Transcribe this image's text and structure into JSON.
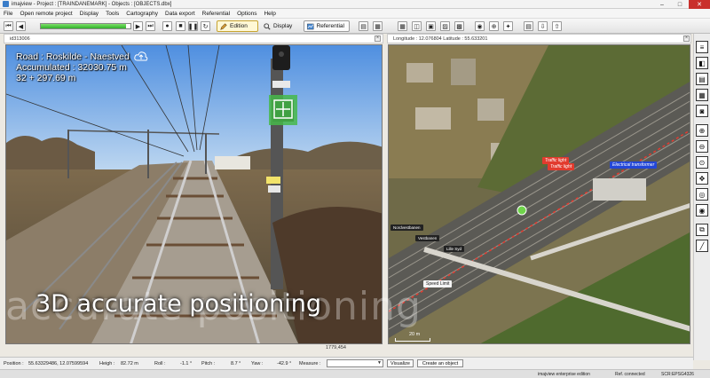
{
  "window": {
    "title": "imajview - Project : [TRAINDANEMARK] - Objects : [OBJECTS.dbx]",
    "controls": [
      "–",
      "□",
      "✕"
    ]
  },
  "menu": [
    "File",
    "Open remote project",
    "Display",
    "Tools",
    "Cartography",
    "Data export",
    "Referential",
    "Options",
    "Help"
  ],
  "toolbar": {
    "playback_buttons": [
      "⏮",
      "◀",
      "▶",
      "⏭"
    ],
    "progress_fraction": 0.95,
    "edition_label": "Edition",
    "display_label": "Display",
    "referential_label": "Referential"
  },
  "left_panel": {
    "header": "id313006",
    "road_line": "Road : Roskilde - Naestved",
    "accumulated_line": "Accumulated : 32030.75 m",
    "chainage_line": "32 + 297.69 m",
    "image_counter": "1779,454"
  },
  "right_panel": {
    "header": "Longitude : 12.076804  Latitude : 55.633201",
    "tags": {
      "traffic_light_1": "Traffic light",
      "traffic_light_2": "Traffic light",
      "electrical_transformer": "Electrical transformer",
      "speed_limit": "Speed Limit",
      "street_1": "Nordvestbanen",
      "street_2": "Vestbanen",
      "street_3": "Lille Syd"
    },
    "scale": "20 m"
  },
  "overlay": {
    "watermark": "accurate positioning",
    "caption": "3D accurate positioning"
  },
  "status": {
    "position_label": "Position :",
    "position_value": "55.63329486, 12.07599594",
    "height_label": "Heigh :",
    "height_value": "82.72 m",
    "roll_label": "Roll :",
    "roll_value": "-1.1 °",
    "pitch_label": "Pitch :",
    "pitch_value": "8.7 °",
    "yaw_label": "Yaw :",
    "yaw_value": "-42.9 °",
    "measure_label": "Measure :",
    "visualize_label": "Visualize",
    "create_object_label": "Create an object"
  },
  "footer": {
    "edition": "imajview enterprise edition",
    "connection": "Ref. connected",
    "code": "SCR:EPSG4326"
  },
  "vertical_tools": [
    "layers-icon",
    "split-icon",
    "table-icon",
    "table-icon",
    "camera-icon",
    "zoom-in-icon",
    "zoom-out-icon",
    "zoom-extent-icon",
    "pan-icon",
    "target-icon",
    "draw-icon",
    "measure-icon",
    "ruler-icon"
  ],
  "colors": {
    "tag_red": "#e23b2e",
    "tag_blue": "#2347d8",
    "progress_green": "#2fb12a"
  }
}
